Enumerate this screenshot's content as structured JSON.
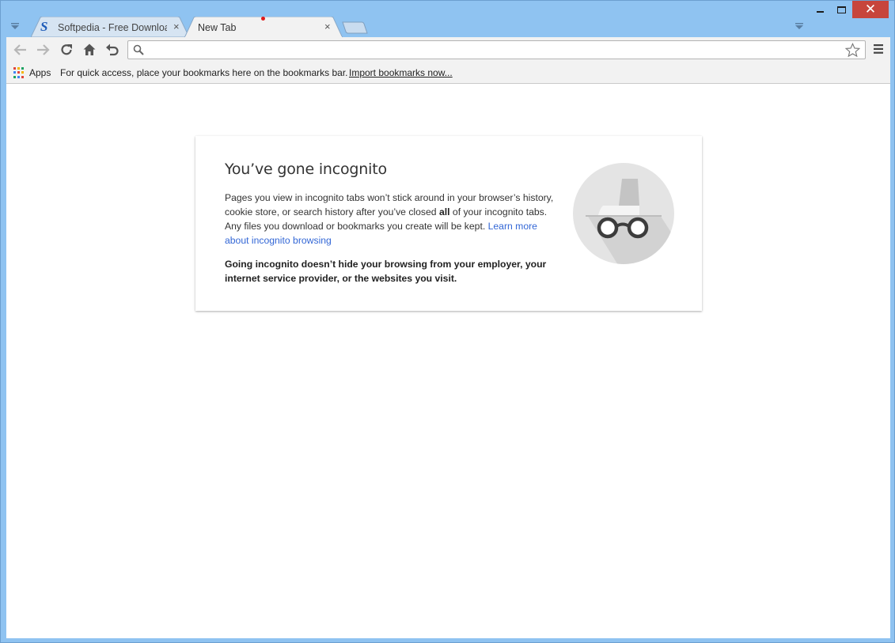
{
  "window": {
    "minimize_label": "Minimize",
    "maximize_label": "Maximize",
    "close_label": "Close"
  },
  "tabs": [
    {
      "title": "Softpedia - Free Downloa",
      "active": false,
      "favicon": "softpedia-s-icon",
      "close": "×"
    },
    {
      "title": "New Tab",
      "active": true,
      "close": "×"
    }
  ],
  "toolbar": {
    "back": "back-arrow-icon",
    "forward": "forward-arrow-icon",
    "reload": "reload-icon",
    "home": "home-icon",
    "undo": "undo-icon",
    "omnibox_value": "",
    "omnibox_placeholder": "",
    "bookmark_star": "star-icon",
    "menu": "hamburger-menu-icon"
  },
  "bookmarks_bar": {
    "apps_label": "Apps",
    "hint": "For quick access, place your bookmarks here on the bookmarks bar.",
    "import_link": "Import bookmarks now..."
  },
  "incognito": {
    "heading": "You’ve gone incognito",
    "p1_part1": "Pages you view in incognito tabs won’t stick around in your browser’s history, cookie store, or search history after you’ve closed ",
    "p1_bold": "all",
    "p1_part2": " of your incognito tabs. Any files you download or bookmarks you create will be kept. ",
    "learn_more": "Learn more about incognito browsing",
    "warning": "Going incognito doesn’t hide your browsing from your employer, your internet service provider, or the websites you visit.",
    "illustration": "incognito-spy-icon"
  },
  "colors": {
    "frame": "#8fc3f1",
    "close_button": "#c7453c",
    "link": "#3367d6",
    "toolbar": "#f2f2f2"
  }
}
